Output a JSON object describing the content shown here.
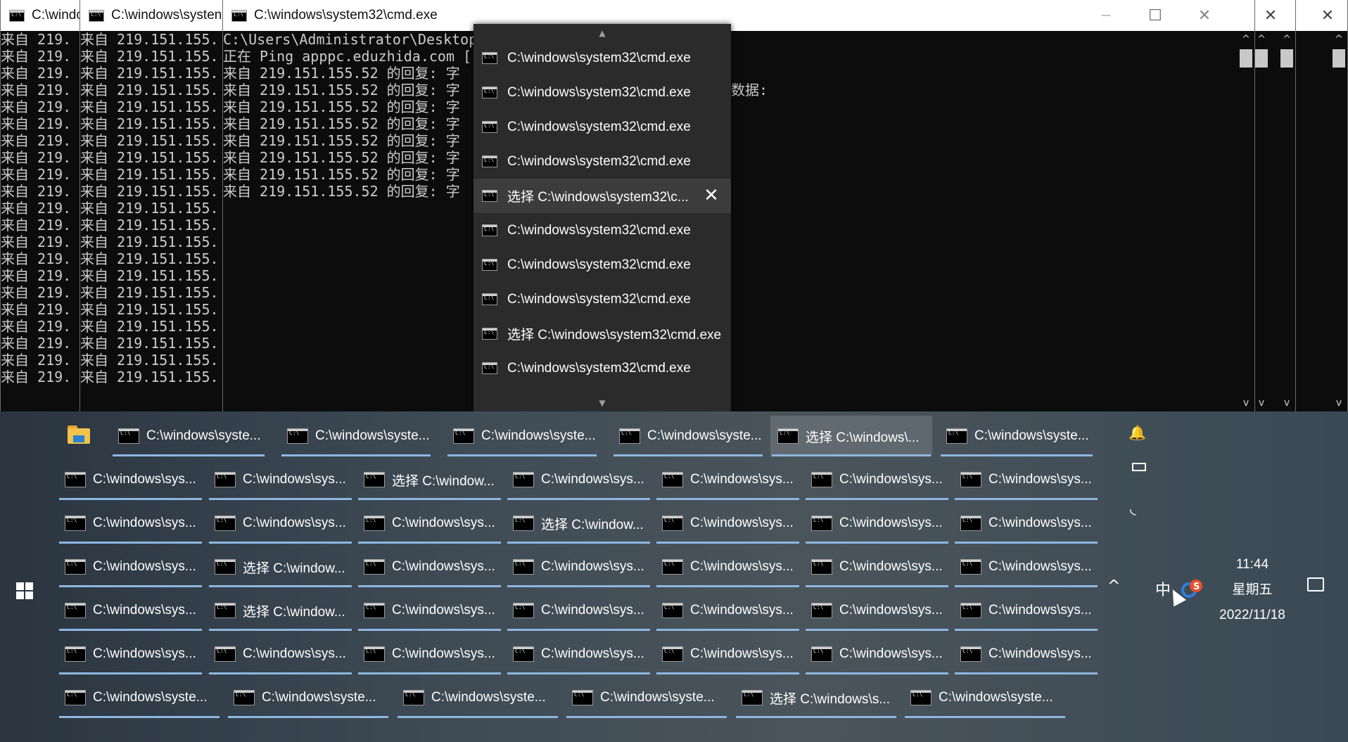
{
  "windows": {
    "w1_title": "C:\\windc",
    "w2_title": "C:\\windows\\systen",
    "main_title": "C:\\windows\\system32\\cmd.exe",
    "w1_lines": [
      "来自 219.",
      "来自 219.",
      "来自 219.",
      "来自 219.",
      "来自 219.",
      "来自 219.",
      "来自 219.",
      "来自 219.",
      "来自 219.",
      "来自 219.",
      "来自 219.",
      "来自 219.",
      "来自 219.",
      "来自 219.",
      "来自 219.",
      "来自 219.",
      "来自 219.",
      "来自 219.",
      "来自 219.",
      "来自 219.",
      "来自 219."
    ],
    "w2_lines": [
      "来自 219.151.155.",
      "来自 219.151.155.",
      "来自 219.151.155.",
      "来自 219.151.155.",
      "来自 219.151.155.",
      "来自 219.151.155.",
      "来自 219.151.155.",
      "来自 219.151.155.",
      "来自 219.151.155.",
      "来自 219.151.155.",
      "来自 219.151.155.",
      "来自 219.151.155.",
      "来自 219.151.155.",
      "来自 219.151.155.",
      "来自 219.151.155.",
      "来自 219.151.155.",
      "来自 219.151.155.",
      "来自 219.151.155.",
      "来自 219.151.155.",
      "来自 219.151.155.",
      "来自 219.151.155."
    ],
    "main_lines": [
      "",
      "C:\\Users\\Administrator\\Desktop",
      "",
      "正在 Ping apppc.eduzhida.com [",
      "来自 219.151.155.52 的回复: 字",
      "来自 219.151.155.52 的回复: 字",
      "来自 219.151.155.52 的回复: 字",
      "来自 219.151.155.52 的回复: 字",
      "来自 219.151.155.52 的回复: 字",
      "来自 219.151.155.52 的回复: 字",
      "来自 219.151.155.52 的回复: 字",
      "来自 219.151.155.52 的回复: 字"
    ],
    "main_right_text": "数据:",
    "minimize": "—",
    "maximize": "☐",
    "close": "✕"
  },
  "popup": {
    "items": [
      "C:\\windows\\system32\\cmd.exe",
      "C:\\windows\\system32\\cmd.exe",
      "C:\\windows\\system32\\cmd.exe",
      "C:\\windows\\system32\\cmd.exe",
      "选择 C:\\windows\\system32\\c...",
      "C:\\windows\\system32\\cmd.exe",
      "C:\\windows\\system32\\cmd.exe",
      "C:\\windows\\system32\\cmd.exe",
      "选择 C:\\windows\\system32\\cmd.exe",
      "C:\\windows\\system32\\cmd.exe"
    ],
    "close_glyph": "✕",
    "scroll_up": "▲",
    "scroll_down": "▼"
  },
  "taskbar": {
    "row1": [
      "C:\\windows\\syste...",
      "C:\\windows\\syste...",
      "C:\\windows\\syste...",
      "C:\\windows\\syste...",
      "选择 C:\\windows\\...",
      "C:\\windows\\syste..."
    ],
    "row2": [
      "C:\\windows\\sys...",
      "C:\\windows\\sys...",
      "选择 C:\\window...",
      "C:\\windows\\sys...",
      "C:\\windows\\sys...",
      "C:\\windows\\sys...",
      "C:\\windows\\sys..."
    ],
    "row3": [
      "C:\\windows\\sys...",
      "C:\\windows\\sys...",
      "C:\\windows\\sys...",
      "选择 C:\\window...",
      "C:\\windows\\sys...",
      "C:\\windows\\sys...",
      "C:\\windows\\sys..."
    ],
    "row4": [
      "C:\\windows\\sys...",
      "选择 C:\\window...",
      "C:\\windows\\sys...",
      "C:\\windows\\sys...",
      "C:\\windows\\sys...",
      "C:\\windows\\sys...",
      "C:\\windows\\sys..."
    ],
    "row5": [
      "C:\\windows\\sys...",
      "选择 C:\\window...",
      "C:\\windows\\sys...",
      "C:\\windows\\sys...",
      "C:\\windows\\sys...",
      "C:\\windows\\sys...",
      "C:\\windows\\sys..."
    ],
    "row6": [
      "C:\\windows\\sys...",
      "C:\\windows\\sys...",
      "C:\\windows\\sys...",
      "C:\\windows\\sys...",
      "C:\\windows\\sys...",
      "C:\\windows\\sys...",
      "C:\\windows\\sys..."
    ],
    "row7": [
      "C:\\windows\\syste...",
      "C:\\windows\\syste...",
      "C:\\windows\\syste...",
      "C:\\windows\\syste...",
      "选择 C:\\windows\\s...",
      "C:\\windows\\syste..."
    ],
    "underline_color": "#8fb6e0"
  },
  "tray": {
    "time": "11:44",
    "weekday": "星期五",
    "date": "2022/11/18",
    "ime": "中",
    "chevron": "^",
    "bell": "🔔",
    "battery": "▭",
    "network": "◟"
  },
  "icons": [
    "cmd-icon",
    "folder-icon",
    "windows-start-icon",
    "bell-icon",
    "battery-icon",
    "network-icon",
    "chevron-up-icon",
    "sogou-icon",
    "notification-icon",
    "close-icon"
  ]
}
